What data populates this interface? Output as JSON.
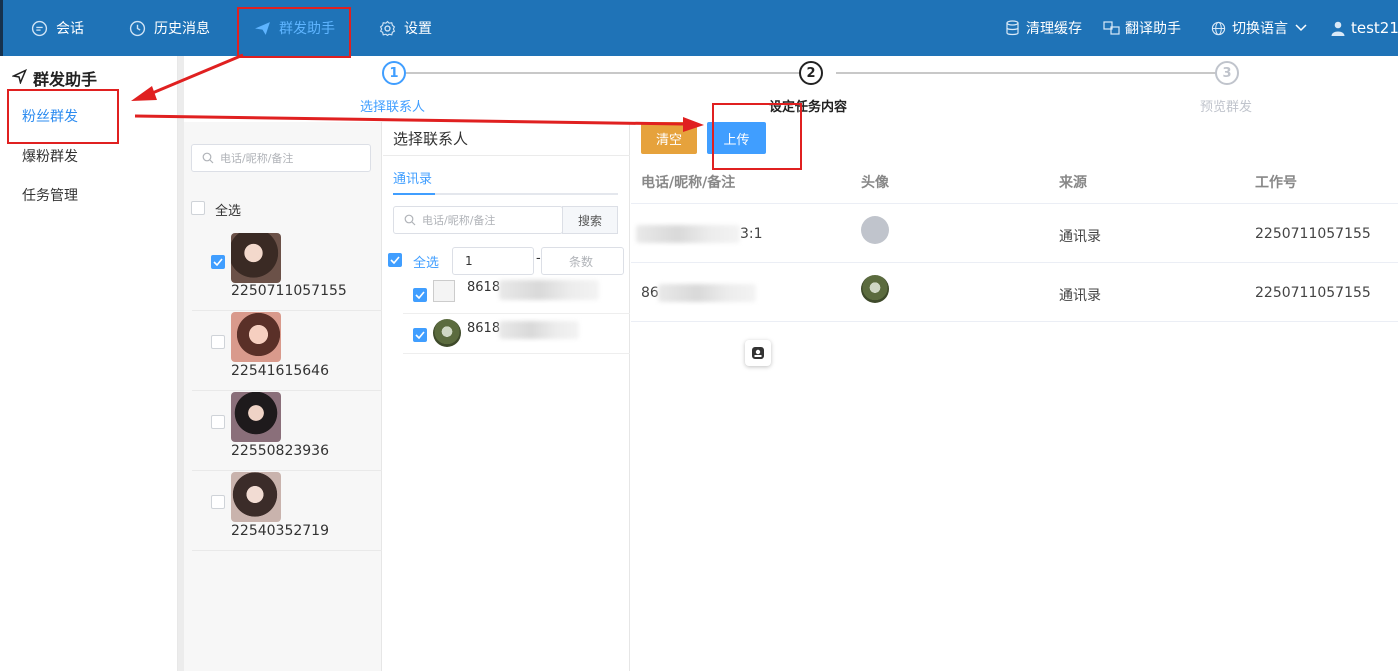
{
  "topnav": {
    "items": [
      {
        "label": "会话",
        "icon": "chat-icon"
      },
      {
        "label": "历史消息",
        "icon": "clock-icon"
      },
      {
        "label": "群发助手",
        "icon": "send-icon",
        "active": true
      },
      {
        "label": "设置",
        "icon": "gear-icon"
      }
    ],
    "right": [
      {
        "label": "清理缓存",
        "icon": "database-icon"
      },
      {
        "label": "翻译助手",
        "icon": "translate-icon"
      },
      {
        "label": "切换语言",
        "icon": "globe-icon"
      },
      {
        "label": "test21",
        "icon": "user-icon"
      }
    ],
    "bar_color": "#1f73b7",
    "active_color": "#5eb4ff"
  },
  "leftmenu": {
    "title": "群发助手",
    "items": [
      {
        "label": "粉丝群发",
        "active": true
      },
      {
        "label": "爆粉群发"
      },
      {
        "label": "任务管理"
      }
    ]
  },
  "fans": {
    "search_placeholder": "电话/昵称/备注",
    "select_all": "全选",
    "rows": [
      {
        "id": "2250711057155",
        "checked": true
      },
      {
        "id": "22541615646",
        "checked": false
      },
      {
        "id": "22550823936",
        "checked": false
      },
      {
        "id": "22540352719",
        "checked": false
      }
    ]
  },
  "contacts": {
    "title": "选择联系人",
    "tab": "通讯录",
    "search_placeholder": "电话/昵称/备注",
    "search_button": "搜索",
    "select_all": "全选",
    "range_start": "1",
    "range_end_placeholder": "条数",
    "range_sep": "-",
    "rows": [
      {
        "prefix": "8618",
        "checked": true
      },
      {
        "prefix": "8618",
        "checked": true
      }
    ]
  },
  "steps": [
    {
      "num": "1",
      "label": "选择联系人",
      "state": "done"
    },
    {
      "num": "2",
      "label": "设定任务内容",
      "state": "active"
    },
    {
      "num": "3",
      "label": "预览群发",
      "state": "pending"
    }
  ],
  "actions": {
    "clear": "清空",
    "upload": "上传",
    "clear_color": "#e6a23c",
    "upload_color": "#409eff"
  },
  "table": {
    "headers": [
      "电话/昵称/备注",
      "头像",
      "来源",
      "工作号"
    ],
    "rows": [
      {
        "phone_visible": "3:1",
        "source": "通讯录",
        "workno": "2250711057155"
      },
      {
        "phone_visible": "86",
        "source": "通讯录",
        "workno": "2250711057155"
      }
    ]
  }
}
